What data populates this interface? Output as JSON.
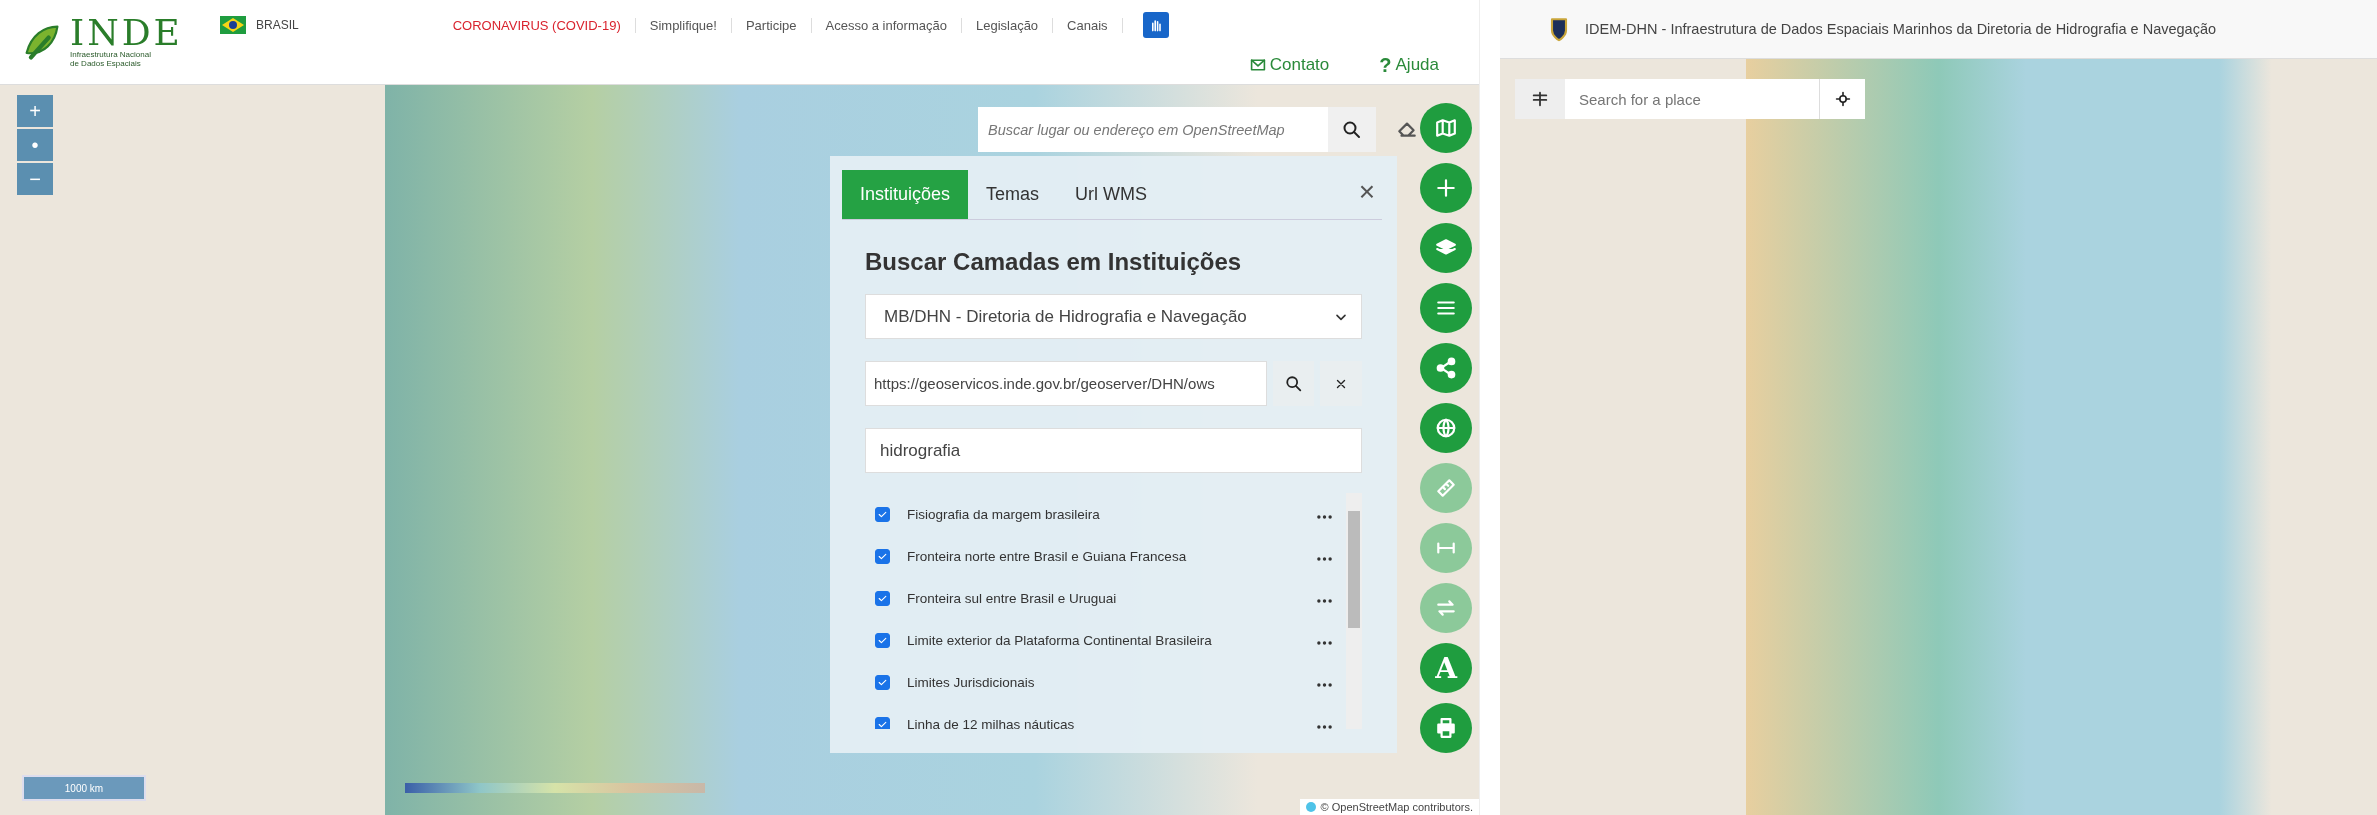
{
  "left_app": {
    "logo": {
      "name": "INDE",
      "subtitle": "Infraestrutura Nacional de Dados Espaciais"
    },
    "country": "BRASIL",
    "nav": [
      {
        "label": "CORONAVIRUS (COVID-19)",
        "highlighted": true
      },
      {
        "label": "Simplifique!",
        "highlighted": false
      },
      {
        "label": "Participe",
        "highlighted": false
      },
      {
        "label": "Acesso a informação",
        "highlighted": false
      },
      {
        "label": "Legislação",
        "highlighted": false
      },
      {
        "label": "Canais",
        "highlighted": false
      }
    ],
    "links": [
      {
        "kind": "mail",
        "label": "Contato"
      },
      {
        "kind": "help",
        "glyph": "?",
        "label": "Ajuda"
      }
    ],
    "zoom_controls": [
      "+",
      "•",
      "−"
    ],
    "map_search": {
      "placeholder": "Buscar lugar ou endereço em OpenStreetMap"
    },
    "panel": {
      "tabs": [
        {
          "label": "Instituições",
          "selected": true
        },
        {
          "label": "Temas",
          "selected": false
        },
        {
          "label": "Url WMS",
          "selected": false
        }
      ],
      "close": "×",
      "title": "Buscar Camadas em Instituições",
      "institution": "MB/DHN - Diretoria de Hidrografia e Navegação",
      "url": "https://geoservicos.inde.gov.br/geoserver/DHN/ows",
      "keyword": "hidrografia",
      "layers": [
        {
          "name": "Fisiografia da margem brasileira",
          "checked": true
        },
        {
          "name": "Fronteira norte entre Brasil e Guiana Francesa",
          "checked": true
        },
        {
          "name": "Fronteira sul entre Brasil e Uruguai",
          "checked": true
        },
        {
          "name": "Limite exterior da Plataforma Continental Brasileira",
          "checked": true
        },
        {
          "name": "Limites Jurisdicionais",
          "checked": true
        },
        {
          "name": "Linha de 12 milhas náuticas",
          "checked": true
        }
      ]
    },
    "tool_buttons": [
      {
        "kind": "map",
        "disabled": false
      },
      {
        "kind": "plus",
        "disabled": false
      },
      {
        "kind": "layers",
        "disabled": false
      },
      {
        "kind": "list",
        "disabled": false
      },
      {
        "kind": "share",
        "disabled": false
      },
      {
        "kind": "globe",
        "disabled": false
      },
      {
        "kind": "ruler",
        "disabled": true
      },
      {
        "kind": "measure",
        "disabled": true
      },
      {
        "kind": "swap",
        "disabled": true
      },
      {
        "kind": "text",
        "label": "A",
        "disabled": false
      },
      {
        "kind": "print",
        "disabled": false
      }
    ],
    "scale": "1000 km",
    "attribution": "© OpenStreetMap contributors."
  },
  "right_app": {
    "title": "IDEM-DHN - Infraestrutura de Dados Espaciais Marinhos da Diretoria de Hidrografia e Navegação",
    "search": {
      "placeholder": "Search for a place"
    }
  }
}
